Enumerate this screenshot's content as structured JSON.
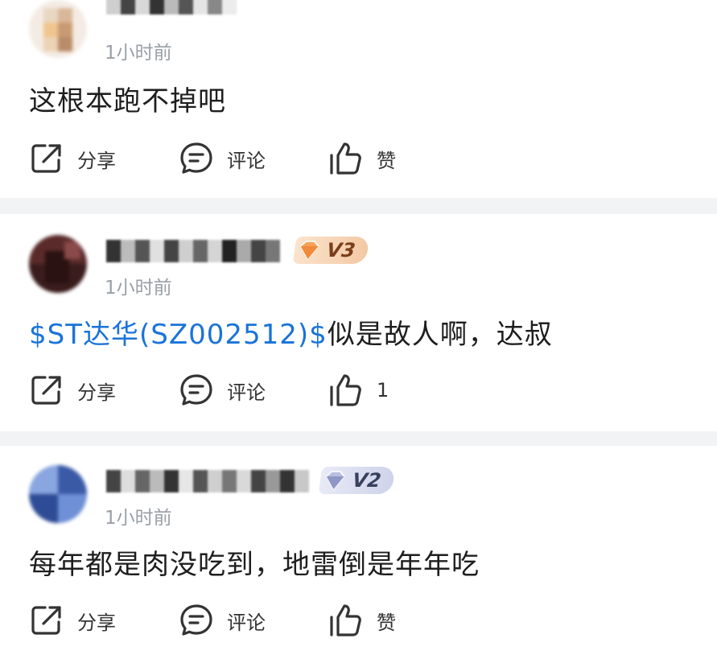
{
  "posts": [
    {
      "time": "1小时前",
      "badge": "",
      "content_link": "",
      "content_text": "这根本跑不掉吧",
      "actions": {
        "share": "分享",
        "comment": "评论",
        "like": "赞"
      }
    },
    {
      "time": "1小时前",
      "badge": "V3",
      "content_link": "$ST达华(SZ002512)$",
      "content_text": "似是故人啊，达叔",
      "actions": {
        "share": "分享",
        "comment": "评论",
        "like": "1"
      }
    },
    {
      "time": "1小时前",
      "badge": "V2",
      "content_link": "",
      "content_text": "每年都是肉没吃到，地雷倒是年年吃",
      "actions": {
        "share": "分享",
        "comment": "评论",
        "like": "赞"
      }
    }
  ],
  "colors": {
    "link": "#1a73d9",
    "time": "#9aa0a6",
    "divider": "#f2f3f5"
  },
  "icons": [
    "share-icon",
    "comment-icon",
    "like-icon",
    "diamond-icon"
  ]
}
